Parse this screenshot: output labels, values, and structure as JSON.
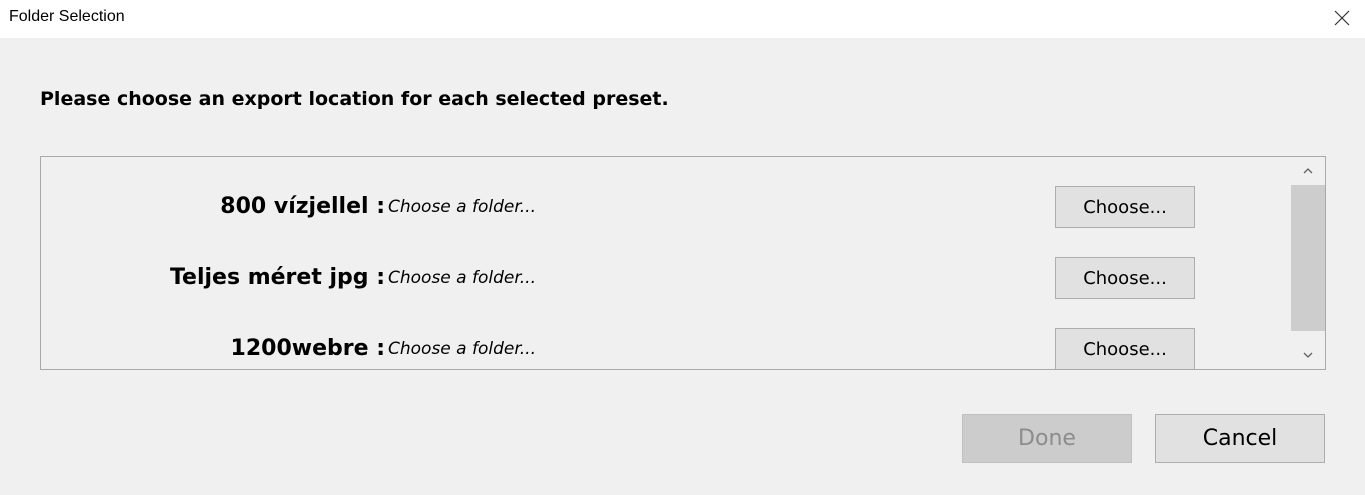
{
  "window": {
    "title": "Folder Selection",
    "close_icon": "close-icon"
  },
  "heading": "Please choose an export location for each selected preset.",
  "presets": [
    {
      "label": "800 vízjellel :",
      "path": "Choose a folder...",
      "button": "Choose..."
    },
    {
      "label": "Teljes méret jpg :",
      "path": "Choose a folder...",
      "button": "Choose..."
    },
    {
      "label": "1200webre :",
      "path": "Choose a folder...",
      "button": "Choose..."
    }
  ],
  "scrollbar": {
    "up_icon": "chevron-up-icon",
    "down_icon": "chevron-down-icon"
  },
  "footer": {
    "done_label": "Done",
    "done_enabled": false,
    "cancel_label": "Cancel"
  },
  "colors": {
    "background": "#f0f0f0",
    "titlebar": "#ffffff",
    "button_face": "#e1e1e1",
    "button_border": "#adadad",
    "disabled_text": "#8c8c8c",
    "scroll_thumb": "#cdcdcd"
  }
}
